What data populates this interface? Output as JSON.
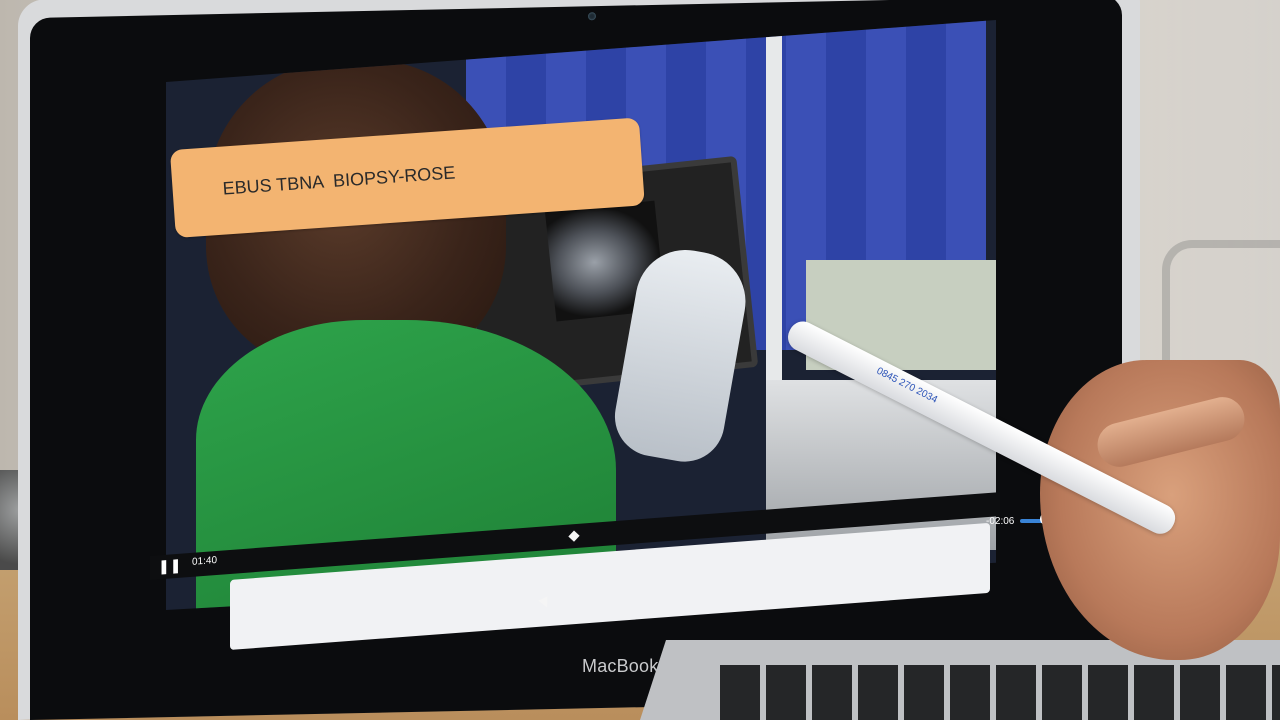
{
  "laptop": {
    "brand_label": "MacBook Pro"
  },
  "video": {
    "caption": "EBUS TBNA  BIOPSY-ROSE",
    "time_elapsed": "01:40",
    "time_remaining": "-02:06",
    "play_state_icon": "pause-icon"
  },
  "pen": {
    "imprint": "0845 270 2034"
  },
  "colors": {
    "caption_background": "#f3b471",
    "scrub_accent": "#3a84d6"
  }
}
